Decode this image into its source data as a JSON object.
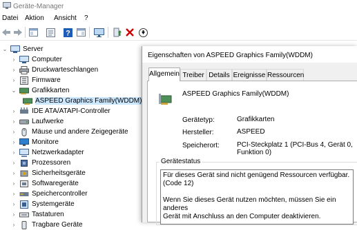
{
  "window": {
    "title": "Geräte-Manager"
  },
  "menu": {
    "items": [
      "Datei",
      "Aktion",
      "Ansicht",
      "?"
    ]
  },
  "toolbar": {
    "buttons": [
      "back-icon",
      "forward-icon",
      "device-view-icon",
      "properties-icon",
      "help-icon",
      "resources-view-icon",
      "monitor-icon",
      "update-driver-icon",
      "uninstall-icon",
      "download-icon"
    ]
  },
  "tree": {
    "root": "Server",
    "items": [
      "Computer",
      "Druckwarteschlangen",
      "Firmware",
      "Grafikkarten",
      "ASPEED Graphics Family(WDDM)",
      "IDE ATA/ATAPI-Controller",
      "Laufwerke",
      "Mäuse und andere Zeigegeräte",
      "Monitore",
      "Netzwerkadapter",
      "Prozessoren",
      "Sicherheitsgeräte",
      "Softwaregeräte",
      "Speichercontroller",
      "Systemgeräte",
      "Tastaturen",
      "Tragbare Geräte"
    ]
  },
  "dialog": {
    "title": "Eigenschaften von ASPEED Graphics Family(WDDM)",
    "tabs": [
      "Allgemein",
      "Treiber",
      "Details",
      "Ereignisse",
      "Ressourcen"
    ],
    "device_name": "ASPEED Graphics Family(WDDM)",
    "labels": {
      "type": "Gerätetyp:",
      "maker": "Hersteller:",
      "location": "Speicherort:"
    },
    "values": {
      "type": "Grafikkarten",
      "maker": "ASPEED",
      "location_line1": "PCI-Steckplatz 1 (PCI-Bus 4, Gerät 0,",
      "location_line2": "Funktion 0)"
    },
    "status_legend": "Gerätestatus",
    "status_line1": "Für dieses Gerät sind nicht genügend Ressourcen verfügbar.",
    "status_line2": "(Code 12)",
    "status_line3": "Wenn Sie dieses Gerät nutzen möchten, müssen Sie ein anderes",
    "status_line4": "Gerät mit Anschluss an den Computer deaktivieren."
  },
  "colors": {
    "selection": "#cce8ff",
    "uninstall": "#d00000",
    "update": "#2a8a2a",
    "help": "#1c5bb8"
  }
}
